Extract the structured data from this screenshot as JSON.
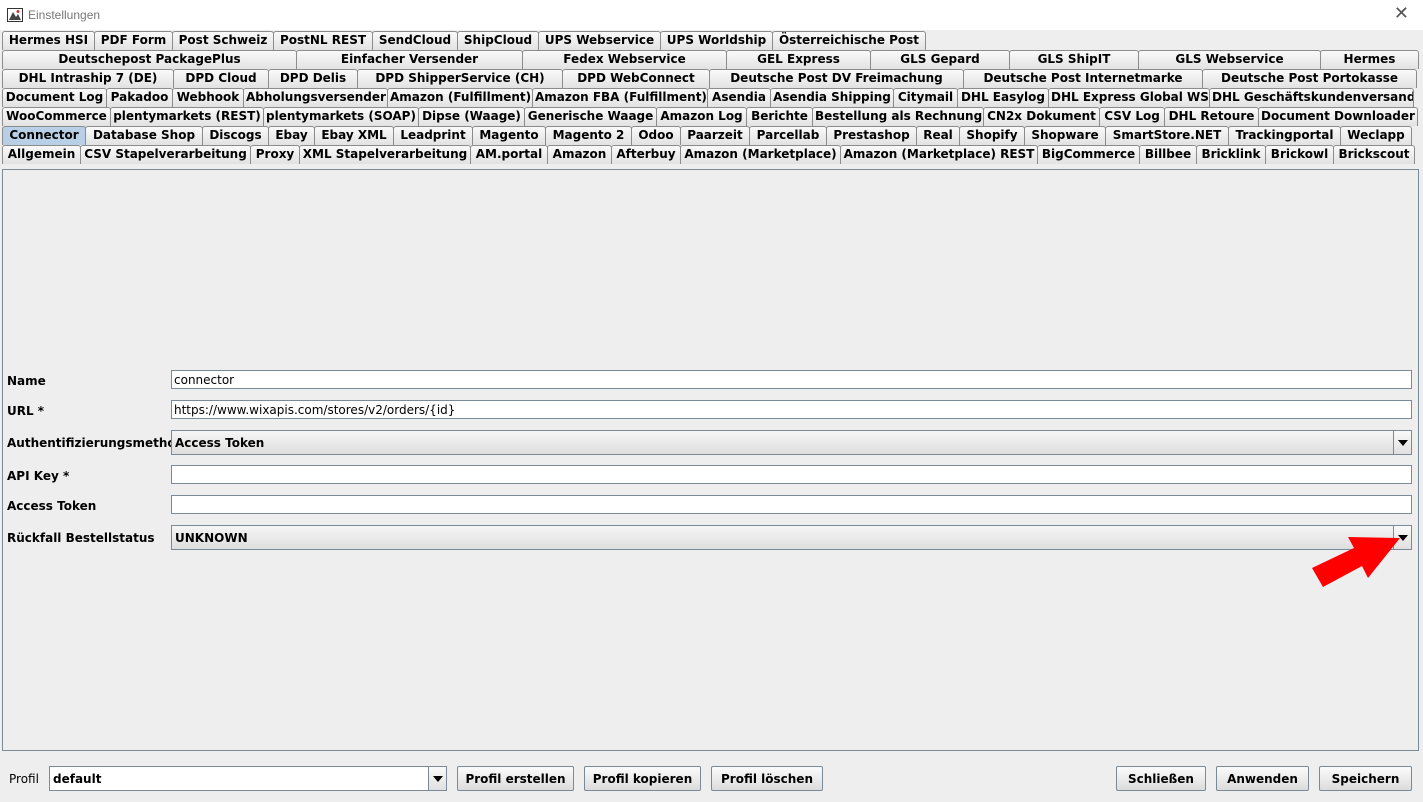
{
  "window": {
    "title": "Einstellungen",
    "close_glyph": "✕"
  },
  "tabs": {
    "rows": [
      [
        "Hermes HSI",
        "PDF Form",
        "Post Schweiz",
        "PostNL REST",
        "SendCloud",
        "ShipCloud",
        "UPS Webservice",
        "UPS Worldship",
        "Österreichische Post"
      ],
      [
        "Deutschepost PackagePlus",
        "Einfacher Versender",
        "Fedex Webservice",
        "GEL Express",
        "GLS Gepard",
        "GLS ShipIT",
        "GLS Webservice",
        "Hermes"
      ],
      [
        "DHL Intraship 7 (DE)",
        "DPD Cloud",
        "DPD Delis",
        "DPD ShipperService (CH)",
        "DPD WebConnect",
        "Deutsche Post DV Freimachung",
        "Deutsche Post Internetmarke",
        "Deutsche Post Portokasse"
      ],
      [
        "Document Log",
        "Pakadoo",
        "Webhook",
        "Abholungsversender",
        "Amazon (Fulfillment)",
        "Amazon FBA (Fulfillment)",
        "Asendia",
        "Asendia Shipping",
        "Citymail",
        "DHL Easylog",
        "DHL Express Global WS",
        "DHL Geschäftskundenversand"
      ],
      [
        "WooCommerce",
        "plentymarkets (REST)",
        "plentymarkets (SOAP)",
        "Dipse (Waage)",
        "Generische Waage",
        "Amazon Log",
        "Berichte",
        "Bestellung als Rechnung",
        "CN2x Dokument",
        "CSV Log",
        "DHL Retoure",
        "Document Downloader"
      ],
      [
        "Connector",
        "Database Shop",
        "Discogs",
        "Ebay",
        "Ebay XML",
        "Leadprint",
        "Magento",
        "Magento 2",
        "Odoo",
        "Paarzeit",
        "Parcellab",
        "Prestashop",
        "Real",
        "Shopify",
        "Shopware",
        "SmartStore.NET",
        "Trackingportal",
        "Weclapp"
      ],
      [
        "Allgemein",
        "CSV Stapelverarbeitung",
        "Proxy",
        "XML Stapelverarbeitung",
        "AM.portal",
        "Amazon",
        "Afterbuy",
        "Amazon (Marketplace)",
        "Amazon (Marketplace) REST",
        "BigCommerce",
        "Billbee",
        "Bricklink",
        "Brickowl",
        "Brickscout"
      ]
    ],
    "selected": "Connector"
  },
  "form": {
    "name_label": "Name",
    "name_value": "connector",
    "url_label": "URL *",
    "url_value": "https://www.wixapis.com/stores/v2/orders/{id}",
    "auth_label": "Authentifizierungsmethode",
    "auth_value": "Access Token",
    "apikey_label": "API Key *",
    "apikey_value": "",
    "token_label": "Access Token",
    "token_value": "",
    "fallback_label": "Rückfall Bestellstatus",
    "fallback_value": "UNKNOWN"
  },
  "footer": {
    "profil_label": "Profil",
    "profil_value": "default",
    "create_label": "Profil erstellen",
    "copy_label": "Profil kopieren",
    "delete_label": "Profil löschen",
    "close_label": "Schließen",
    "apply_label": "Anwenden",
    "save_label": "Speichern"
  },
  "colors": {
    "selected_tab": "#b8cfe5",
    "annotation_arrow": "#ff0000"
  }
}
